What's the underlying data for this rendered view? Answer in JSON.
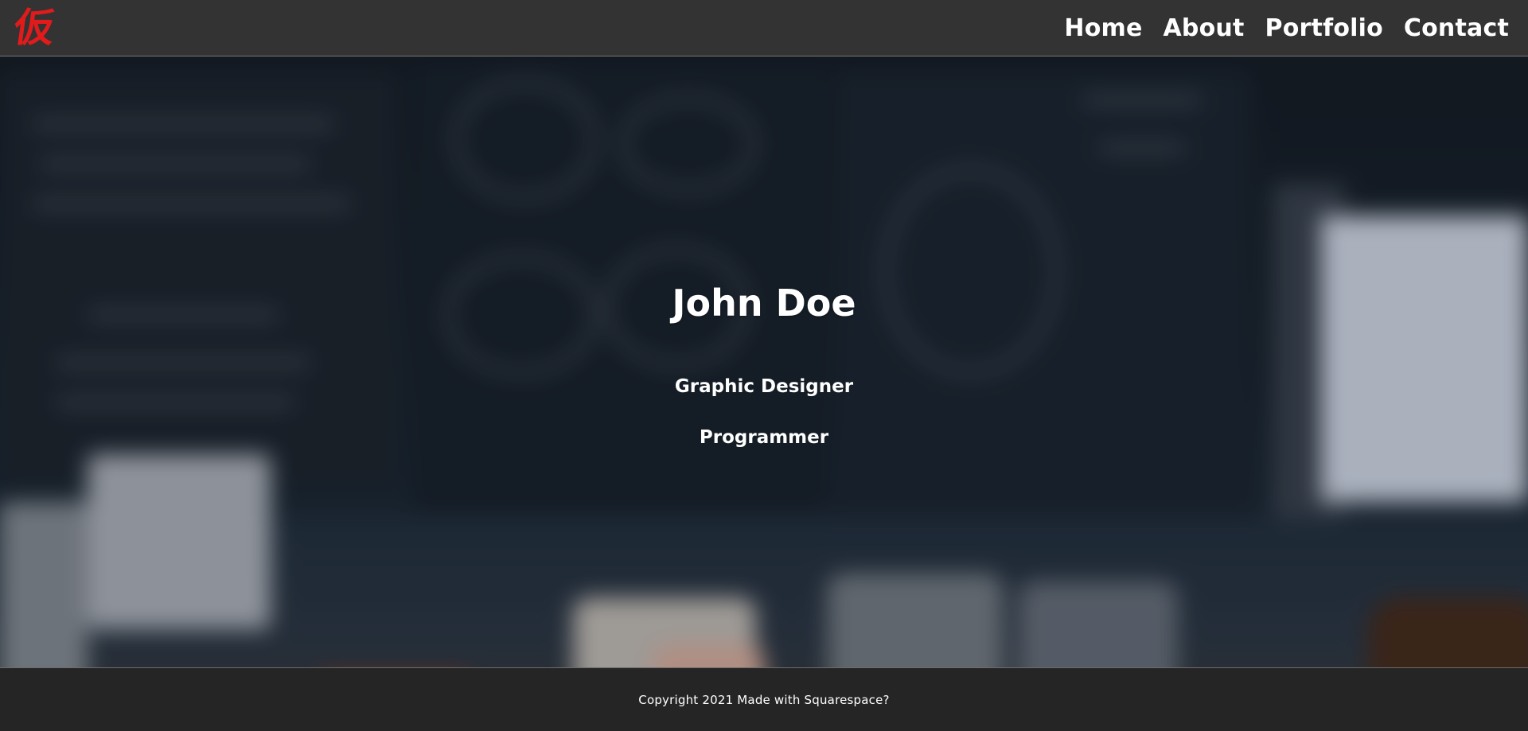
{
  "header": {
    "logo_text": "仮",
    "nav": [
      {
        "label": "Home"
      },
      {
        "label": "About"
      },
      {
        "label": "Portfolio"
      },
      {
        "label": "Contact"
      }
    ]
  },
  "hero": {
    "name": "John Doe",
    "roles": [
      "Graphic Designer",
      "Programmer"
    ]
  },
  "footer": {
    "copyright": "Copyright 2021 Made with Squarespace?"
  },
  "colors": {
    "header_bg": "#333333",
    "footer_bg": "#252525",
    "logo": "#e11b1b",
    "text": "#ffffff"
  }
}
